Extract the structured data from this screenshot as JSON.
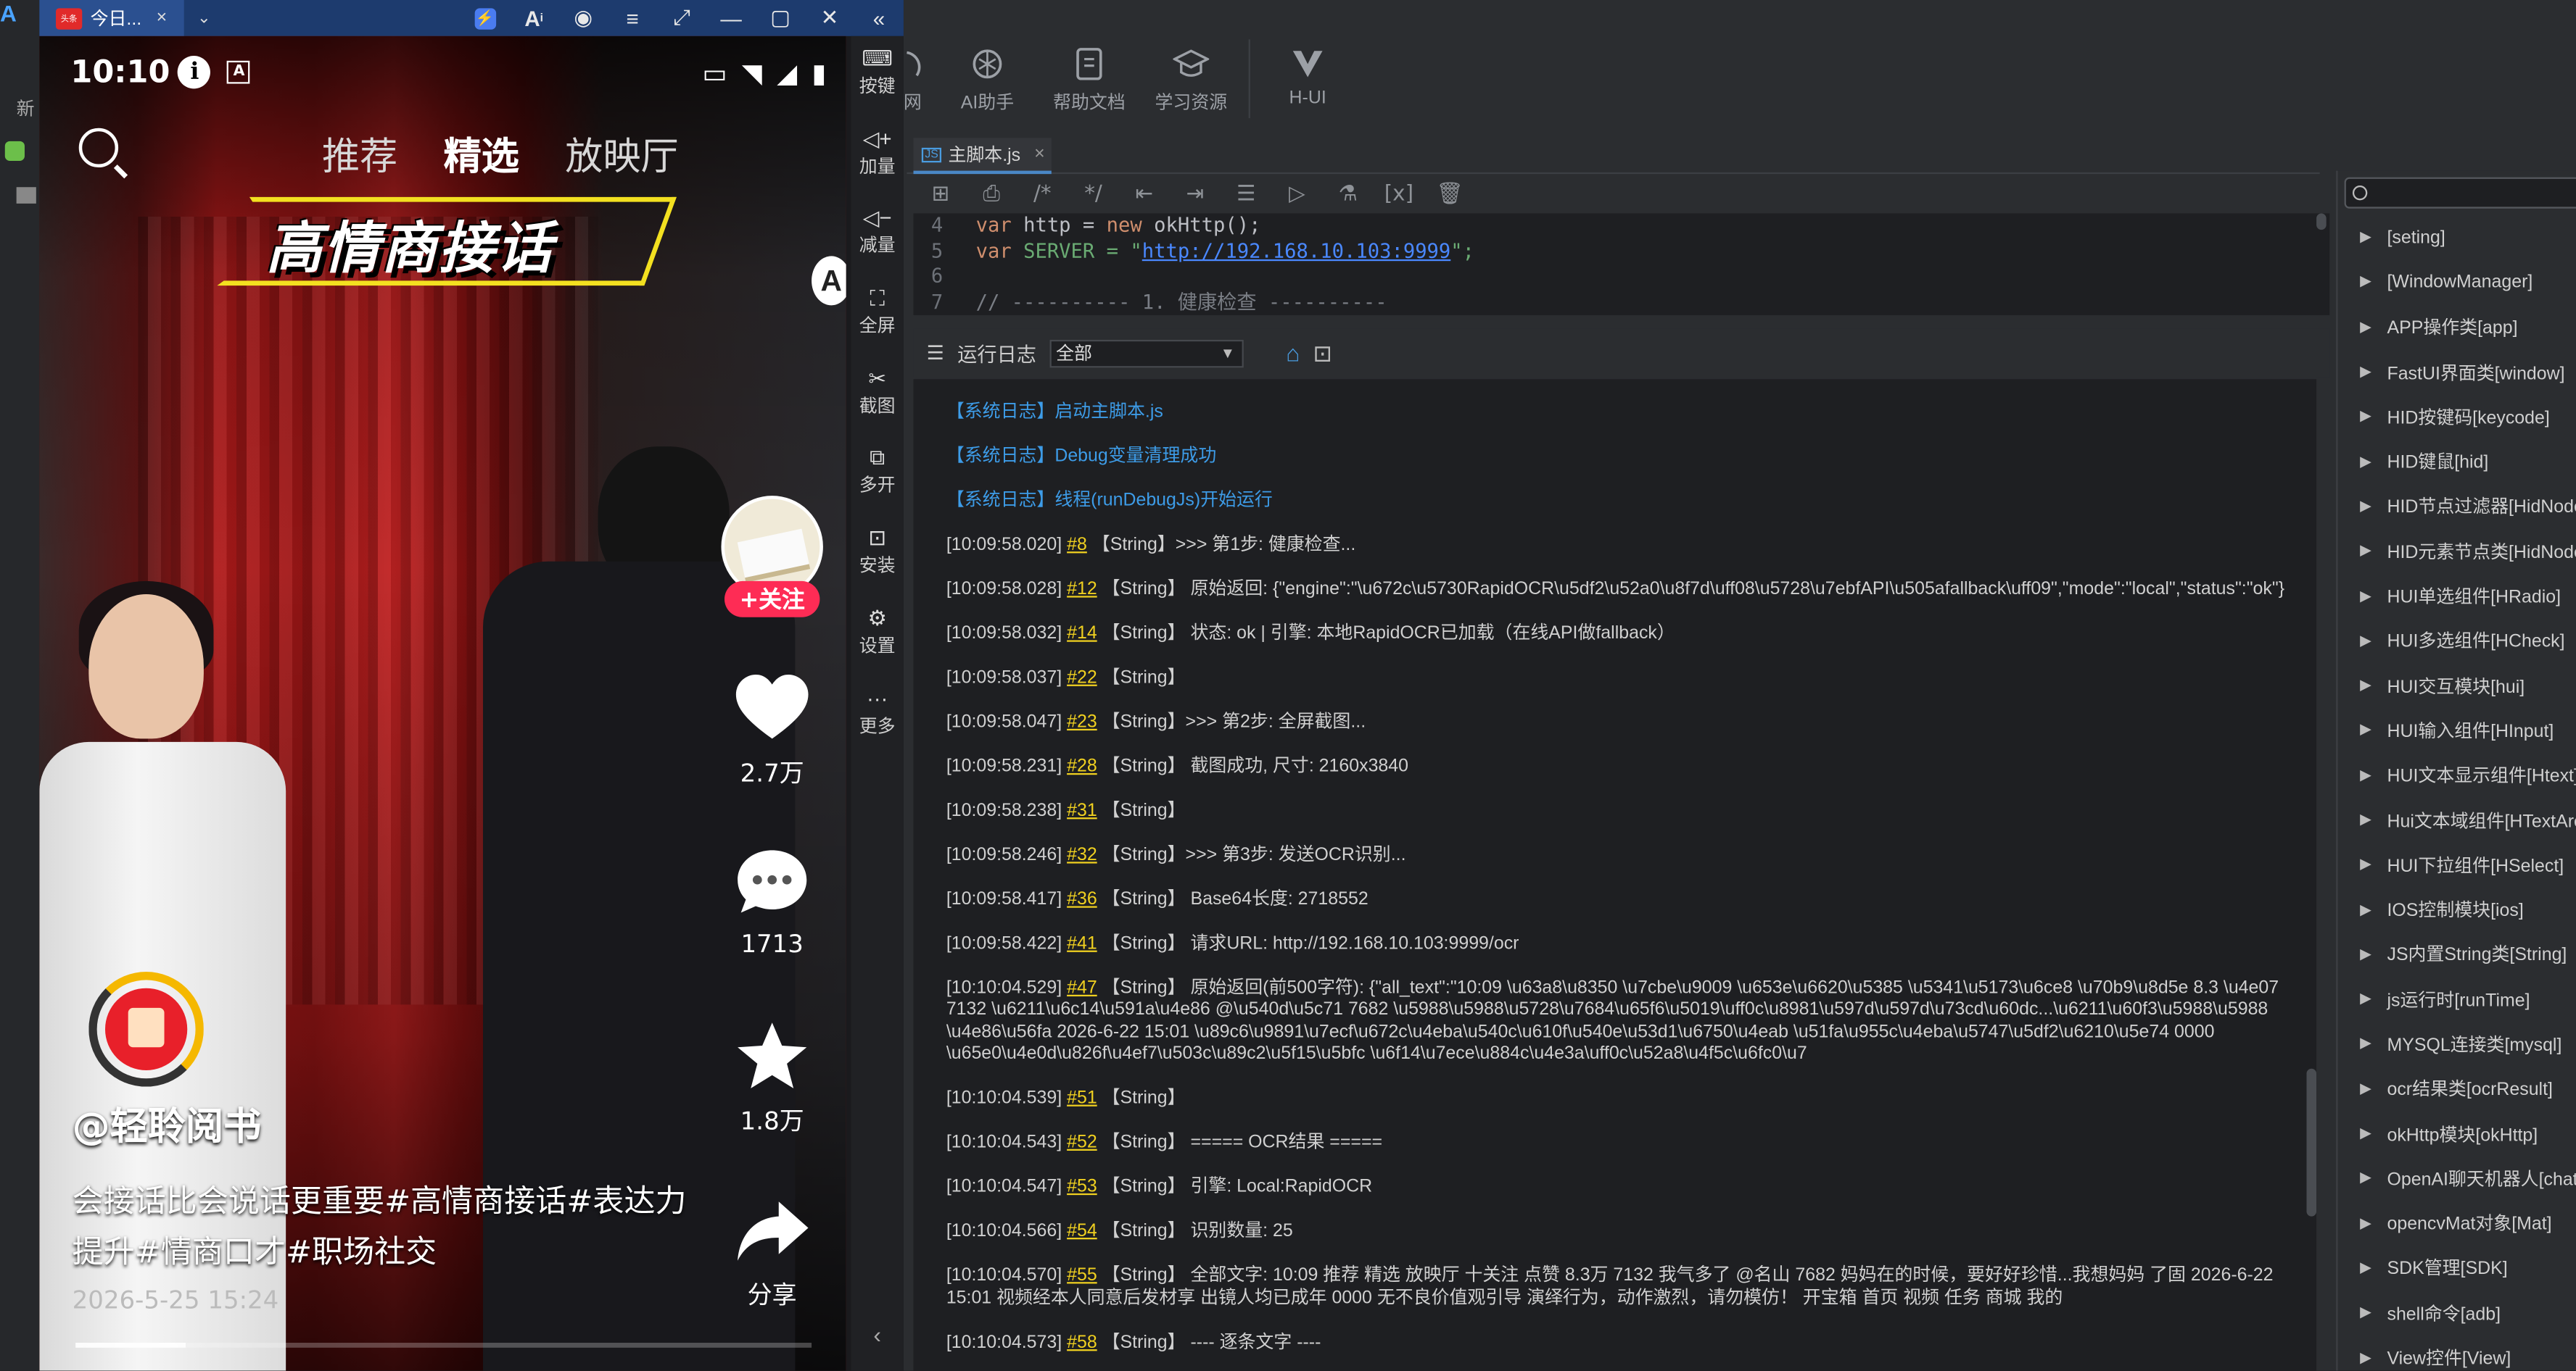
{
  "emulator": {
    "tab_title": "今日...",
    "app_logo_text": "头条",
    "sidebar": [
      {
        "icon": "keyboard-icon",
        "glyph": "⌨",
        "label": "按键"
      },
      {
        "icon": "volume-up-icon",
        "glyph": "◁+",
        "label": "加量"
      },
      {
        "icon": "volume-down-icon",
        "glyph": "◁−",
        "label": "减量"
      },
      {
        "icon": "fullscreen-icon",
        "glyph": "⛶",
        "label": "全屏"
      },
      {
        "icon": "scissors-icon",
        "glyph": "✂",
        "label": "截图"
      },
      {
        "icon": "multi-open-icon",
        "glyph": "⧉",
        "label": "多开"
      },
      {
        "icon": "install-icon",
        "glyph": "⊡",
        "label": "安装"
      },
      {
        "icon": "settings-icon",
        "glyph": "⚙",
        "label": "设置"
      },
      {
        "icon": "more-icon",
        "glyph": "···",
        "label": "更多"
      }
    ],
    "collapse_glyph": "‹"
  },
  "phone": {
    "status_time": "10:10",
    "status_a": "A",
    "tabs": [
      "推荐",
      "精选",
      "放映厅"
    ],
    "active_tab": 1,
    "sticker": "高情商接话",
    "overlay_letter": "A",
    "follow_label": "+关注",
    "likes": "2.7万",
    "comments": "1713",
    "favorites": "1.8万",
    "share_label": "分享",
    "author": "@轻聆阅书",
    "description": "会接话比会说话更重要#高情商接话#表达力提升#情商口才#职场社交",
    "date": "2026-5-25 15:24",
    "progress": 0.15
  },
  "toolbar": [
    {
      "icon": "partial-icon",
      "label": "网"
    },
    {
      "icon": "openai-icon",
      "label": "AI助手"
    },
    {
      "icon": "doc-icon",
      "label": "帮助文档"
    },
    {
      "icon": "graduation-cap-icon",
      "label": "学习资源"
    },
    {
      "icon": "v-logo-icon",
      "label": "H-UI"
    }
  ],
  "editor": {
    "tab": "主脚本.js",
    "js_badge": "JS",
    "code_lines": [
      {
        "n": "4",
        "kw": "var",
        "text": " http = ",
        "kw2": "new",
        "rest": " okHttp();"
      },
      {
        "n": "5",
        "kw": "var",
        "text": " SERVER = \"",
        "url": "http://192.168.10.103:9999",
        "rest": "\";"
      },
      {
        "n": "6",
        "text": ""
      },
      {
        "n": "7",
        "comment": "// ---------- 1. 健康检查 ----------"
      }
    ]
  },
  "log": {
    "title": "运行日志",
    "filter": "全部",
    "lines": [
      {
        "type": "sys",
        "text": "【系统日志】启动主脚本.js"
      },
      {
        "type": "sys",
        "text": "【系统日志】Debug变量清理成功"
      },
      {
        "type": "sys",
        "text": "【系统日志】线程(runDebugJs)开始运行"
      },
      {
        "ts": "[10:09:58.020]",
        "ref": "#8",
        "text": "【String】>>> 第1步: 健康检查..."
      },
      {
        "ts": "[10:09:58.028]",
        "ref": "#12",
        "text": "【String】 原始返回: {\"engine\":\"\\u672c\\u5730RapidOCR\\u5df2\\u52a0\\u8f7d\\uff08\\u5728\\u7ebfAPI\\u505afallback\\uff09\",\"mode\":\"local\",\"status\":\"ok\"}"
      },
      {
        "ts": "[10:09:58.032]",
        "ref": "#14",
        "text": "【String】 状态: ok | 引擎: 本地RapidOCR已加载（在线API做fallback）"
      },
      {
        "ts": "[10:09:58.037]",
        "ref": "#22",
        "text": "【String】"
      },
      {
        "ts": "[10:09:58.047]",
        "ref": "#23",
        "text": "【String】>>> 第2步: 全屏截图..."
      },
      {
        "ts": "[10:09:58.231]",
        "ref": "#28",
        "text": "【String】 截图成功, 尺寸: 2160x3840"
      },
      {
        "ts": "[10:09:58.238]",
        "ref": "#31",
        "text": "【String】"
      },
      {
        "ts": "[10:09:58.246]",
        "ref": "#32",
        "text": "【String】>>> 第3步: 发送OCR识别..."
      },
      {
        "ts": "[10:09:58.417]",
        "ref": "#36",
        "text": "【String】 Base64长度: 2718552"
      },
      {
        "ts": "[10:09:58.422]",
        "ref": "#41",
        "text": "【String】 请求URL: http://192.168.10.103:9999/ocr"
      },
      {
        "ts": "[10:10:04.529]",
        "ref": "#47",
        "text": "【String】 原始返回(前500字符): {\"all_text\":\"10:09 \\u63a8\\u8350 \\u7cbe\\u9009 \\u653e\\u6620\\u5385 \\u5341\\u5173\\u6ce8 \\u70b9\\u8d5e 8.3 \\u4e07 7132 \\u6211\\u6c14\\u591a\\u4e86 @\\u540d\\u5c71 7682 \\u5988\\u5988\\u5728\\u7684\\u65f6\\u5019\\uff0c\\u8981\\u597d\\u597d\\u73cd\\u60dc...\\u6211\\u60f3\\u5988\\u5988 \\u4e86\\u56fa 2026-6-22 15:01 \\u89c6\\u9891\\u7ecf\\u672c\\u4eba\\u540c\\u610f\\u540e\\u53d1\\u6750\\u4eab \\u51fa\\u955c\\u4eba\\u5747\\u5df2\\u6210\\u5e74 0000 \\u65e0\\u4e0d\\u826f\\u4ef7\\u503c\\u89c2\\u5f15\\u5bfc \\u6f14\\u7ece\\u884c\\u4e3a\\uff0c\\u52a8\\u4f5c\\u6fc0\\u7"
      },
      {
        "ts": "[10:10:04.539]",
        "ref": "#51",
        "text": "【String】"
      },
      {
        "ts": "[10:10:04.543]",
        "ref": "#52",
        "text": "【String】 ===== OCR结果 ====="
      },
      {
        "ts": "[10:10:04.547]",
        "ref": "#53",
        "text": "【String】 引擎: Local:RapidOCR"
      },
      {
        "ts": "[10:10:04.566]",
        "ref": "#54",
        "text": "【String】 识别数量: 25"
      },
      {
        "ts": "[10:10:04.570]",
        "ref": "#55",
        "text": "【String】 全部文字: 10:09 推荐 精选 放映厅 十关注 点赞 8.3万 7132 我气多了 @名山 7682 妈妈在的时候，要好好珍惜...我想妈妈 了固 2026-6-22 15:01 视频经本人同意后发材享 出镜人均已成年 0000 无不良价值观引导 演绎行为，动作激烈，请勿模仿！ 开宝箱 首页 视频 任务 商城 我的"
      },
      {
        "ts": "[10:10:04.573]",
        "ref": "#58",
        "text": "【String】 ---- 逐条文字 ----"
      }
    ]
  },
  "api_tree": [
    "[seting]",
    "[WindowManager]",
    "APP操作类[app]",
    "FastUI界面类[window]",
    "HID按键码[keycode]",
    "HID键鼠[hid]",
    "HID节点过滤器[HidNode]",
    "HID元素节点类[HidNode]",
    "HUI单选组件[HRadio]",
    "HUI多选组件[HCheck]",
    "HUI交互模块[hui]",
    "HUI输入组件[HInput]",
    "HUI文本显示组件[Htext]",
    "Hui文本域组件[HTextArea]",
    "HUI下拉组件[HSelect]",
    "IOS控制模块[ios]",
    "JS内置String类[String]",
    "js运行时[runTime]",
    "MYSQL连接类[mysql]",
    "ocr结果类[ocrResult]",
    "okHttp模块[okHttp]",
    "OpenAI聊天机器人[chat]",
    "opencvMat对象[Mat]",
    "SDK管理[SDK]",
    "shell命令[adb]",
    "View控件[View]"
  ],
  "ide_left": {
    "logo": "A",
    "new_label": "新"
  },
  "colors": {
    "accent_blue": "#4a88c7",
    "log_sys": "#3d9ce8",
    "log_ref": "#f0d020",
    "follow_red": "#fe2c55"
  }
}
